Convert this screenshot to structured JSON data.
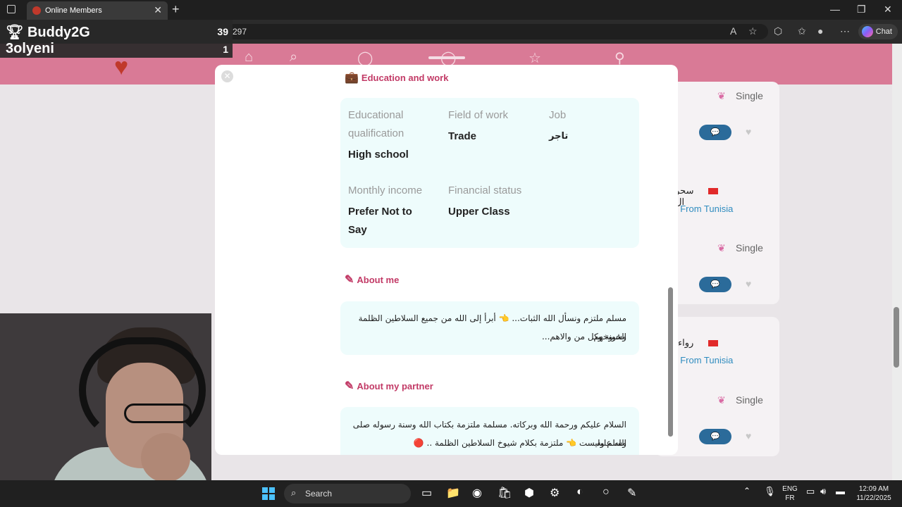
{
  "browser": {
    "tab_title": "Online Members",
    "url_fragment": "297",
    "chat_label": "Chat"
  },
  "scoreboard": {
    "player1": "Buddy2G",
    "score1": "39",
    "player2": "3olyeni",
    "score2": "1"
  },
  "background_cards": [
    {
      "status": "Single"
    },
    {
      "name": "سحر ال",
      "from": ", From Tunisia",
      "status": "Single"
    },
    {
      "name": "رواء",
      "from": ", From Tunisia",
      "status": "Single"
    }
  ],
  "modal": {
    "education": {
      "title": "Education and work",
      "educational_qualification_label": "Educational qualification",
      "educational_qualification_value": "High school",
      "field_of_work_label": "Field of work",
      "field_of_work_value": "Trade",
      "job_label": "Job",
      "job_value": "تاجر",
      "monthly_income_label": "Monthly income",
      "monthly_income_value": "Prefer Not to Say",
      "financial_status_label": "Financial status",
      "financial_status_value": "Upper Class"
    },
    "about_me": {
      "title": "About me",
      "line1": "مسلم ملتزم ونسأل الله الثبات... 👈 أبرأ إلى الله من جميع السلاطين الظلمة وشيوخهم",
      "line2": "الخونة وكل من والاهم..."
    },
    "about_partner": {
      "title": "About my partner",
      "line1": "السلام عليكم ورحمة الله وبركاته. مسلمة ملتزمة بكتاب الله وسنة رسوله صلى الله عليه",
      "line2": "وسلم وليست 👈 ملتزمة بكلام شيوخ السلاطين الظلمة .. 🔴"
    }
  },
  "taskbar": {
    "search_label": "Search",
    "lang1": "ENG",
    "lang2": "FR",
    "time": "12:09 AM",
    "date": "11/22/2025"
  }
}
